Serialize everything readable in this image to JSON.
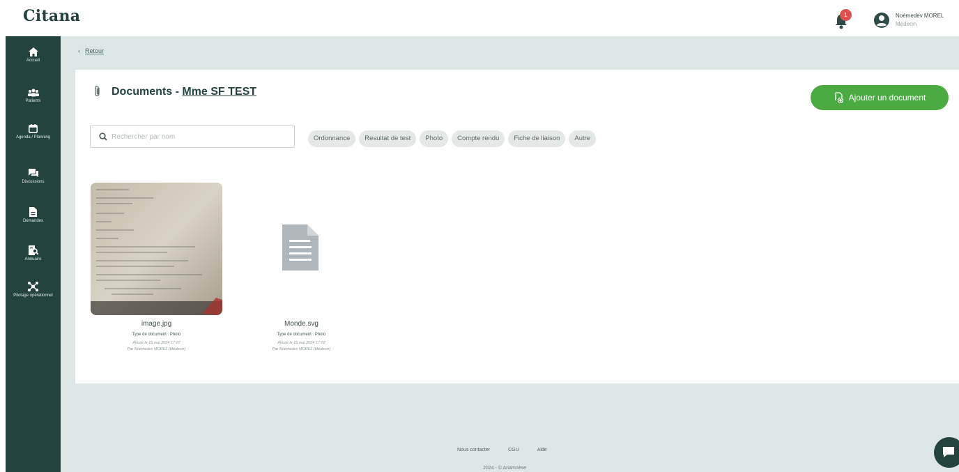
{
  "header": {
    "logo": "Citana",
    "logo_sub": "",
    "notification_count": "1",
    "user_name": "Noémedev MOREL",
    "user_role": "Médecin"
  },
  "sidebar": {
    "items": [
      {
        "label": "Accueil",
        "icon": "home-icon"
      },
      {
        "label": "Patients",
        "icon": "people-icon"
      },
      {
        "label": "Agenda / Planning",
        "icon": "calendar-icon"
      },
      {
        "label": "Discussions",
        "icon": "chat-icon"
      },
      {
        "label": "Demandes",
        "icon": "document-icon"
      },
      {
        "label": "Annuaire",
        "icon": "directory-icon"
      },
      {
        "label": "Pilotage opérationnel",
        "icon": "network-icon"
      }
    ]
  },
  "main": {
    "back_label": "Retour",
    "title_prefix": "Documents - ",
    "patient_name": "Mme SF TEST",
    "add_button_label": "Ajouter un document",
    "search_placeholder": "Rechercher par nom",
    "filters": [
      "Ordonnance",
      "Resultat de test",
      "Photo",
      "Compte rendu",
      "Fiche de liaison",
      "Autre"
    ],
    "files": [
      {
        "name": "image.jpg",
        "type_label": "Type de document :",
        "type_value": "Photo",
        "uploaded": "Ajouté le 16 mai 2024 17:07",
        "by": "Par Noémedev MOREL (Médecin)"
      },
      {
        "name": "Monde.svg",
        "type_label": "Type de document :",
        "type_value": "Photo",
        "uploaded": "Ajouté le 16 mai 2024 17:02",
        "by": "Par Noémedev MOREL (Médecin)"
      }
    ]
  },
  "footer": {
    "links": [
      "Nous contacter",
      "CGU",
      "Aide"
    ],
    "copyright": "2024 - © Anamnèse"
  },
  "colors": {
    "sidebar": "#23433f",
    "accent_green": "#4aab43",
    "badge_red": "#e0504f",
    "background": "#dde7e6"
  }
}
